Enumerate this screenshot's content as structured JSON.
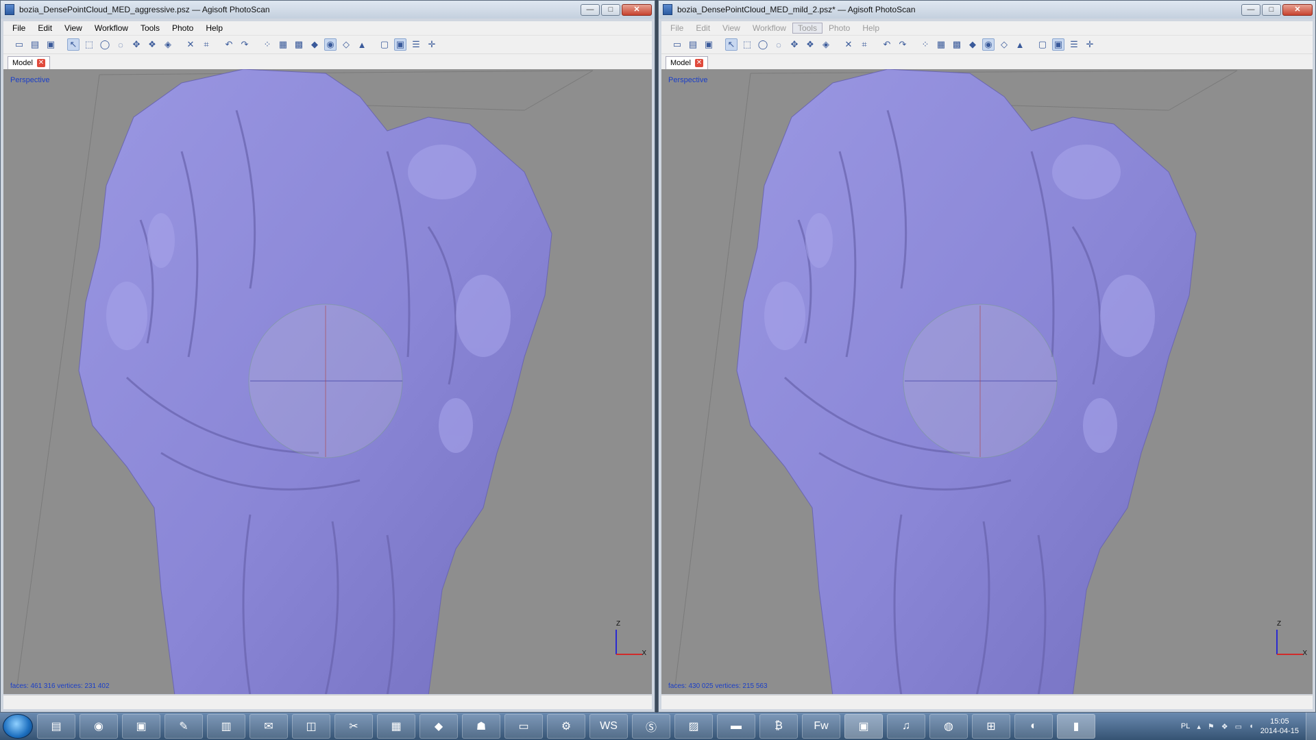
{
  "left_window": {
    "title": "bozia_DensePointCloud_MED_aggressive.psz — Agisoft PhotoScan",
    "menu": [
      "File",
      "Edit",
      "View",
      "Workflow",
      "Tools",
      "Photo",
      "Help"
    ],
    "tab": "Model",
    "viewport_label": "Perspective",
    "stats": "faces: 461 316 vertices: 231 402"
  },
  "right_window": {
    "title": "bozia_DensePointCloud_MED_mild_2.psz* — Agisoft PhotoScan",
    "menu": [
      "File",
      "Edit",
      "View",
      "Workflow",
      "Tools",
      "Photo",
      "Help"
    ],
    "tab": "Model",
    "viewport_label": "Perspective",
    "stats": "faces: 430 025 vertices: 215 563"
  },
  "axis": {
    "z": "Z",
    "x": "X"
  },
  "taskbar": {
    "apps": [
      "explorer-icon",
      "chrome-icon",
      "save-icon",
      "wrench-icon",
      "pdf-icon",
      "mail-icon",
      "box-icon",
      "scissors-icon",
      "calculator-icon",
      "ruby-icon",
      "android-icon",
      "monitor-icon",
      "steam-icon",
      "ws-icon",
      "skype-icon",
      "photo-icon",
      "scanner-icon",
      "bitcoin-icon",
      "fireworks-icon",
      "terminal-icon",
      "itunes-icon",
      "firefox-icon",
      "network-icon",
      "drop-icon",
      "film-icon"
    ],
    "fw_label": "Fw",
    "ws_label": "WS",
    "lang": "PL",
    "time": "15:05",
    "date": "2014-04-15"
  },
  "colors": {
    "mesh": "#8c88d8",
    "viewport_bg": "#8e8e8e",
    "label_blue": "#1a3ec8"
  }
}
